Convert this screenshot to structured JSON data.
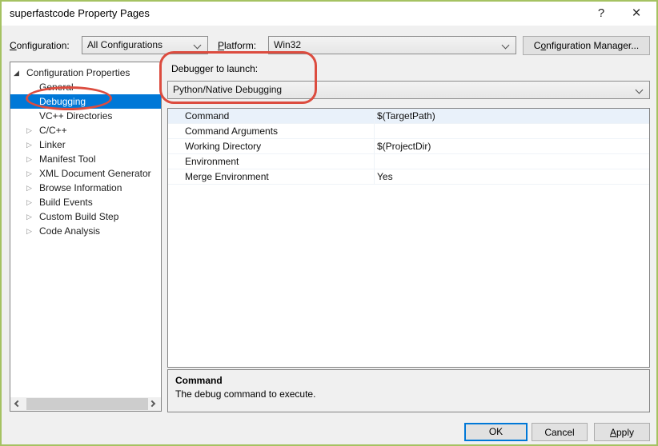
{
  "window": {
    "title": "superfastcode Property Pages",
    "help_icon": "?",
    "close_icon": "×"
  },
  "toolbar": {
    "configuration_label": {
      "key": "C",
      "rest": "onfiguration:"
    },
    "configuration_value": "All Configurations",
    "platform_label": {
      "key": "P",
      "rest": "latform:"
    },
    "platform_value": "Win32",
    "configuration_manager": {
      "pre": "C",
      "key": "o",
      "rest": "nfiguration Manager..."
    }
  },
  "icons": {
    "expanded": "◢",
    "collapsed": "▷"
  },
  "tree": {
    "items": [
      {
        "label": "Configuration Properties"
      },
      {
        "label": "General"
      },
      {
        "label": "Debugging"
      },
      {
        "label": "VC++ Directories"
      },
      {
        "label": "C/C++"
      },
      {
        "label": "Linker"
      },
      {
        "label": "Manifest Tool"
      },
      {
        "label": "XML Document Generator"
      },
      {
        "label": "Browse Information"
      },
      {
        "label": "Build Events"
      },
      {
        "label": "Custom Build Step"
      },
      {
        "label": "Code Analysis"
      }
    ]
  },
  "debugger": {
    "label": "Debugger to launch:",
    "value": "Python/Native Debugging"
  },
  "grid": {
    "rows": [
      {
        "name": "Command",
        "value": "$(TargetPath)"
      },
      {
        "name": "Command Arguments",
        "value": ""
      },
      {
        "name": "Working Directory",
        "value": "$(ProjectDir)"
      },
      {
        "name": "Environment",
        "value": ""
      },
      {
        "name": "Merge Environment",
        "value": "Yes"
      }
    ]
  },
  "description": {
    "title": "Command",
    "text": "The debug command to execute."
  },
  "footer": {
    "ok": "OK",
    "cancel": "Cancel",
    "apply": {
      "key": "A",
      "rest": "pply"
    }
  },
  "colors": {
    "selection": "#0078d7",
    "annotation": "#dc4c3f",
    "window_border": "#a5c262",
    "default_button_border": "#0078d7",
    "dialog_background": "#f0f0f0"
  }
}
